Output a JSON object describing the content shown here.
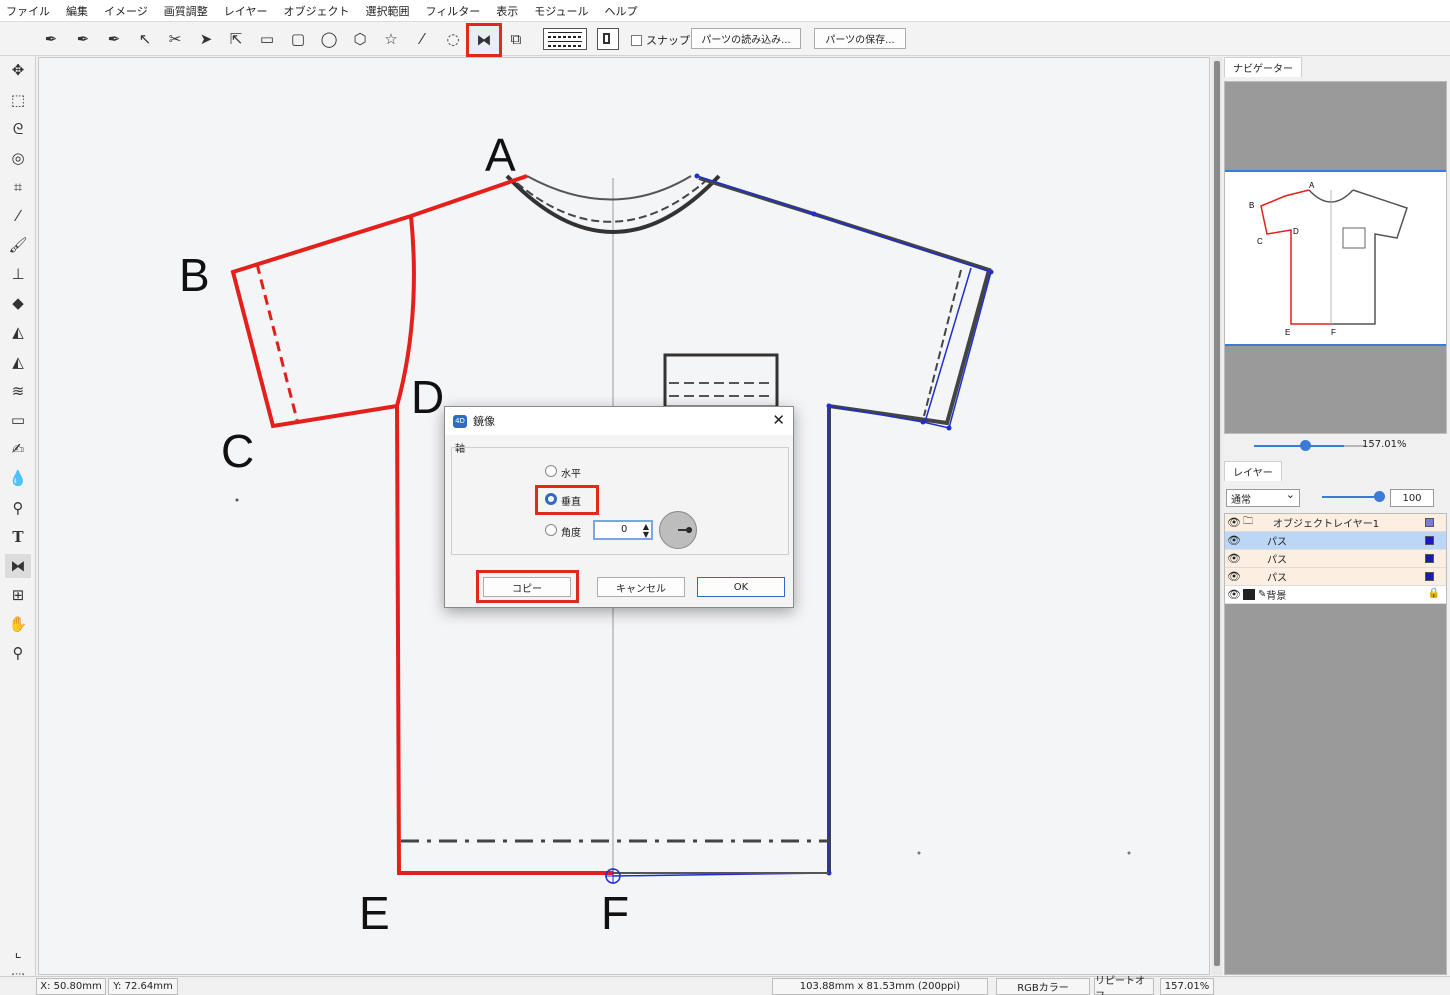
{
  "menu": [
    "ファイル",
    "編集",
    "イメージ",
    "画質調整",
    "レイヤー",
    "オブジェクト",
    "選択範囲",
    "フィルター",
    "表示",
    "モジュール",
    "ヘルプ"
  ],
  "toolbar": {
    "snap_label": "スナップ",
    "load_parts": "パーツの読み込み...",
    "save_parts": "パーツの保存..."
  },
  "canvas": {
    "point_labels": [
      "A",
      "B",
      "C",
      "D",
      "E",
      "F"
    ]
  },
  "navigator": {
    "tab": "ナビゲーター",
    "zoom": "157.01%",
    "thumb_labels": [
      "A",
      "B",
      "C",
      "D",
      "E",
      "F"
    ]
  },
  "layers": {
    "tab": "レイヤー",
    "blend_mode": "通常",
    "opacity": "100",
    "items": [
      {
        "name": "オブジェクトレイヤー1"
      },
      {
        "name": "パス"
      },
      {
        "name": "パス"
      },
      {
        "name": "パス"
      },
      {
        "name": "背景"
      }
    ]
  },
  "dialog": {
    "title": "鏡像",
    "group_label": "軸",
    "horizontal": "水平",
    "vertical": "垂直",
    "angle": "角度",
    "angle_value": "0",
    "copy": "コピー",
    "cancel": "キャンセル",
    "ok": "OK"
  },
  "status": {
    "x_label": "X:",
    "x_value": "50.80mm",
    "y_label": "Y:",
    "y_value": "72.64mm",
    "size": "103.88mm x 81.53mm (200ppi)",
    "color_mode": "RGBカラー",
    "repeat": "リピートオフ",
    "zoom": "157.01%"
  },
  "colors": {
    "highlight": "#e02a1c",
    "path_red": "#e3201b",
    "path_blue": "#1f2fcf",
    "accent": "#3b7bd8"
  }
}
